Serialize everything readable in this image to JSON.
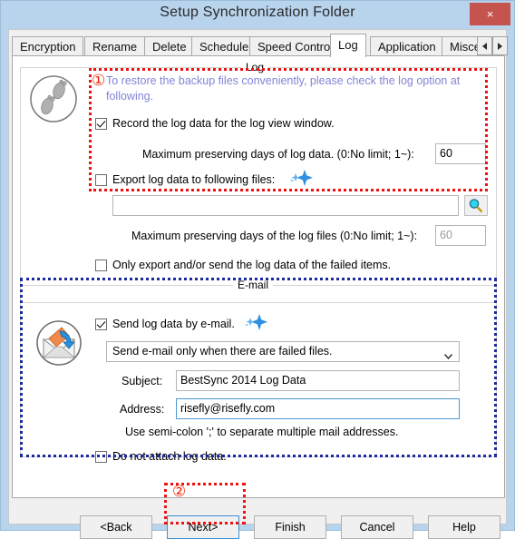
{
  "window": {
    "title": "Setup Synchronization Folder",
    "close_label": "×"
  },
  "tabs": {
    "items": [
      {
        "label": "Encryption",
        "active": false
      },
      {
        "label": "Rename",
        "active": false
      },
      {
        "label": "Delete",
        "active": false
      },
      {
        "label": "Schedule",
        "active": false
      },
      {
        "label": "Speed Control",
        "active": false
      },
      {
        "label": "Log",
        "active": true
      },
      {
        "label": "Application",
        "active": false
      },
      {
        "label": "Misce",
        "active": false
      }
    ],
    "scroll_left_icon": "chevron-left-icon",
    "scroll_right_icon": "chevron-right-icon"
  },
  "log_group": {
    "legend": "Log",
    "section_icon": "footprints-globe-icon",
    "hint": "To restore the backup files conveniently, please check the log option at following.",
    "record_log_label": "Record the log data for the log view window.",
    "record_log_checked": true,
    "max_days_log_data_label": "Maximum preserving days of log data. (0:No limit; 1~):",
    "max_days_log_data_value": "60",
    "export_log_label": "Export log data to following files:",
    "export_log_checked": false,
    "export_new_badge": "new-star-icon",
    "export_path_value": "",
    "browse_icon": "magnifier-icon",
    "max_days_log_files_label": "Maximum preserving days of the log files (0:No limit; 1~):",
    "max_days_log_files_value": "60",
    "only_failed_label": "Only export and/or send the log data of the failed items.",
    "only_failed_checked": false
  },
  "email_group": {
    "legend": "E-mail",
    "section_icon": "envelope-send-icon",
    "send_email_label": "Send log data by e-mail.",
    "send_email_checked": true,
    "send_new_badge": "new-star-icon",
    "condition_selected": "Send e-mail only when there are failed files.",
    "subject_label": "Subject:",
    "subject_value": "BestSync 2014 Log Data",
    "address_label": "Address:",
    "address_value": "risefly@risefly.com",
    "address_hint": "Use semi-colon ';' to separate multiple mail addresses.",
    "no_attach_label": "Do not attach log data.",
    "no_attach_checked": false
  },
  "footer": {
    "back_label": "<Back",
    "next_label": "Next>",
    "finish_label": "Finish",
    "cancel_label": "Cancel",
    "help_label": "Help"
  },
  "annotations": {
    "marker_one": "①",
    "marker_two": "②"
  },
  "colors": {
    "titlebar": "#b8d3ec",
    "close_button": "#c5544f",
    "annotation_red": "#ee1111",
    "annotation_blue": "#1a2a9c",
    "hint_text": "#8484d8",
    "focus_border": "#3d8fd4"
  }
}
